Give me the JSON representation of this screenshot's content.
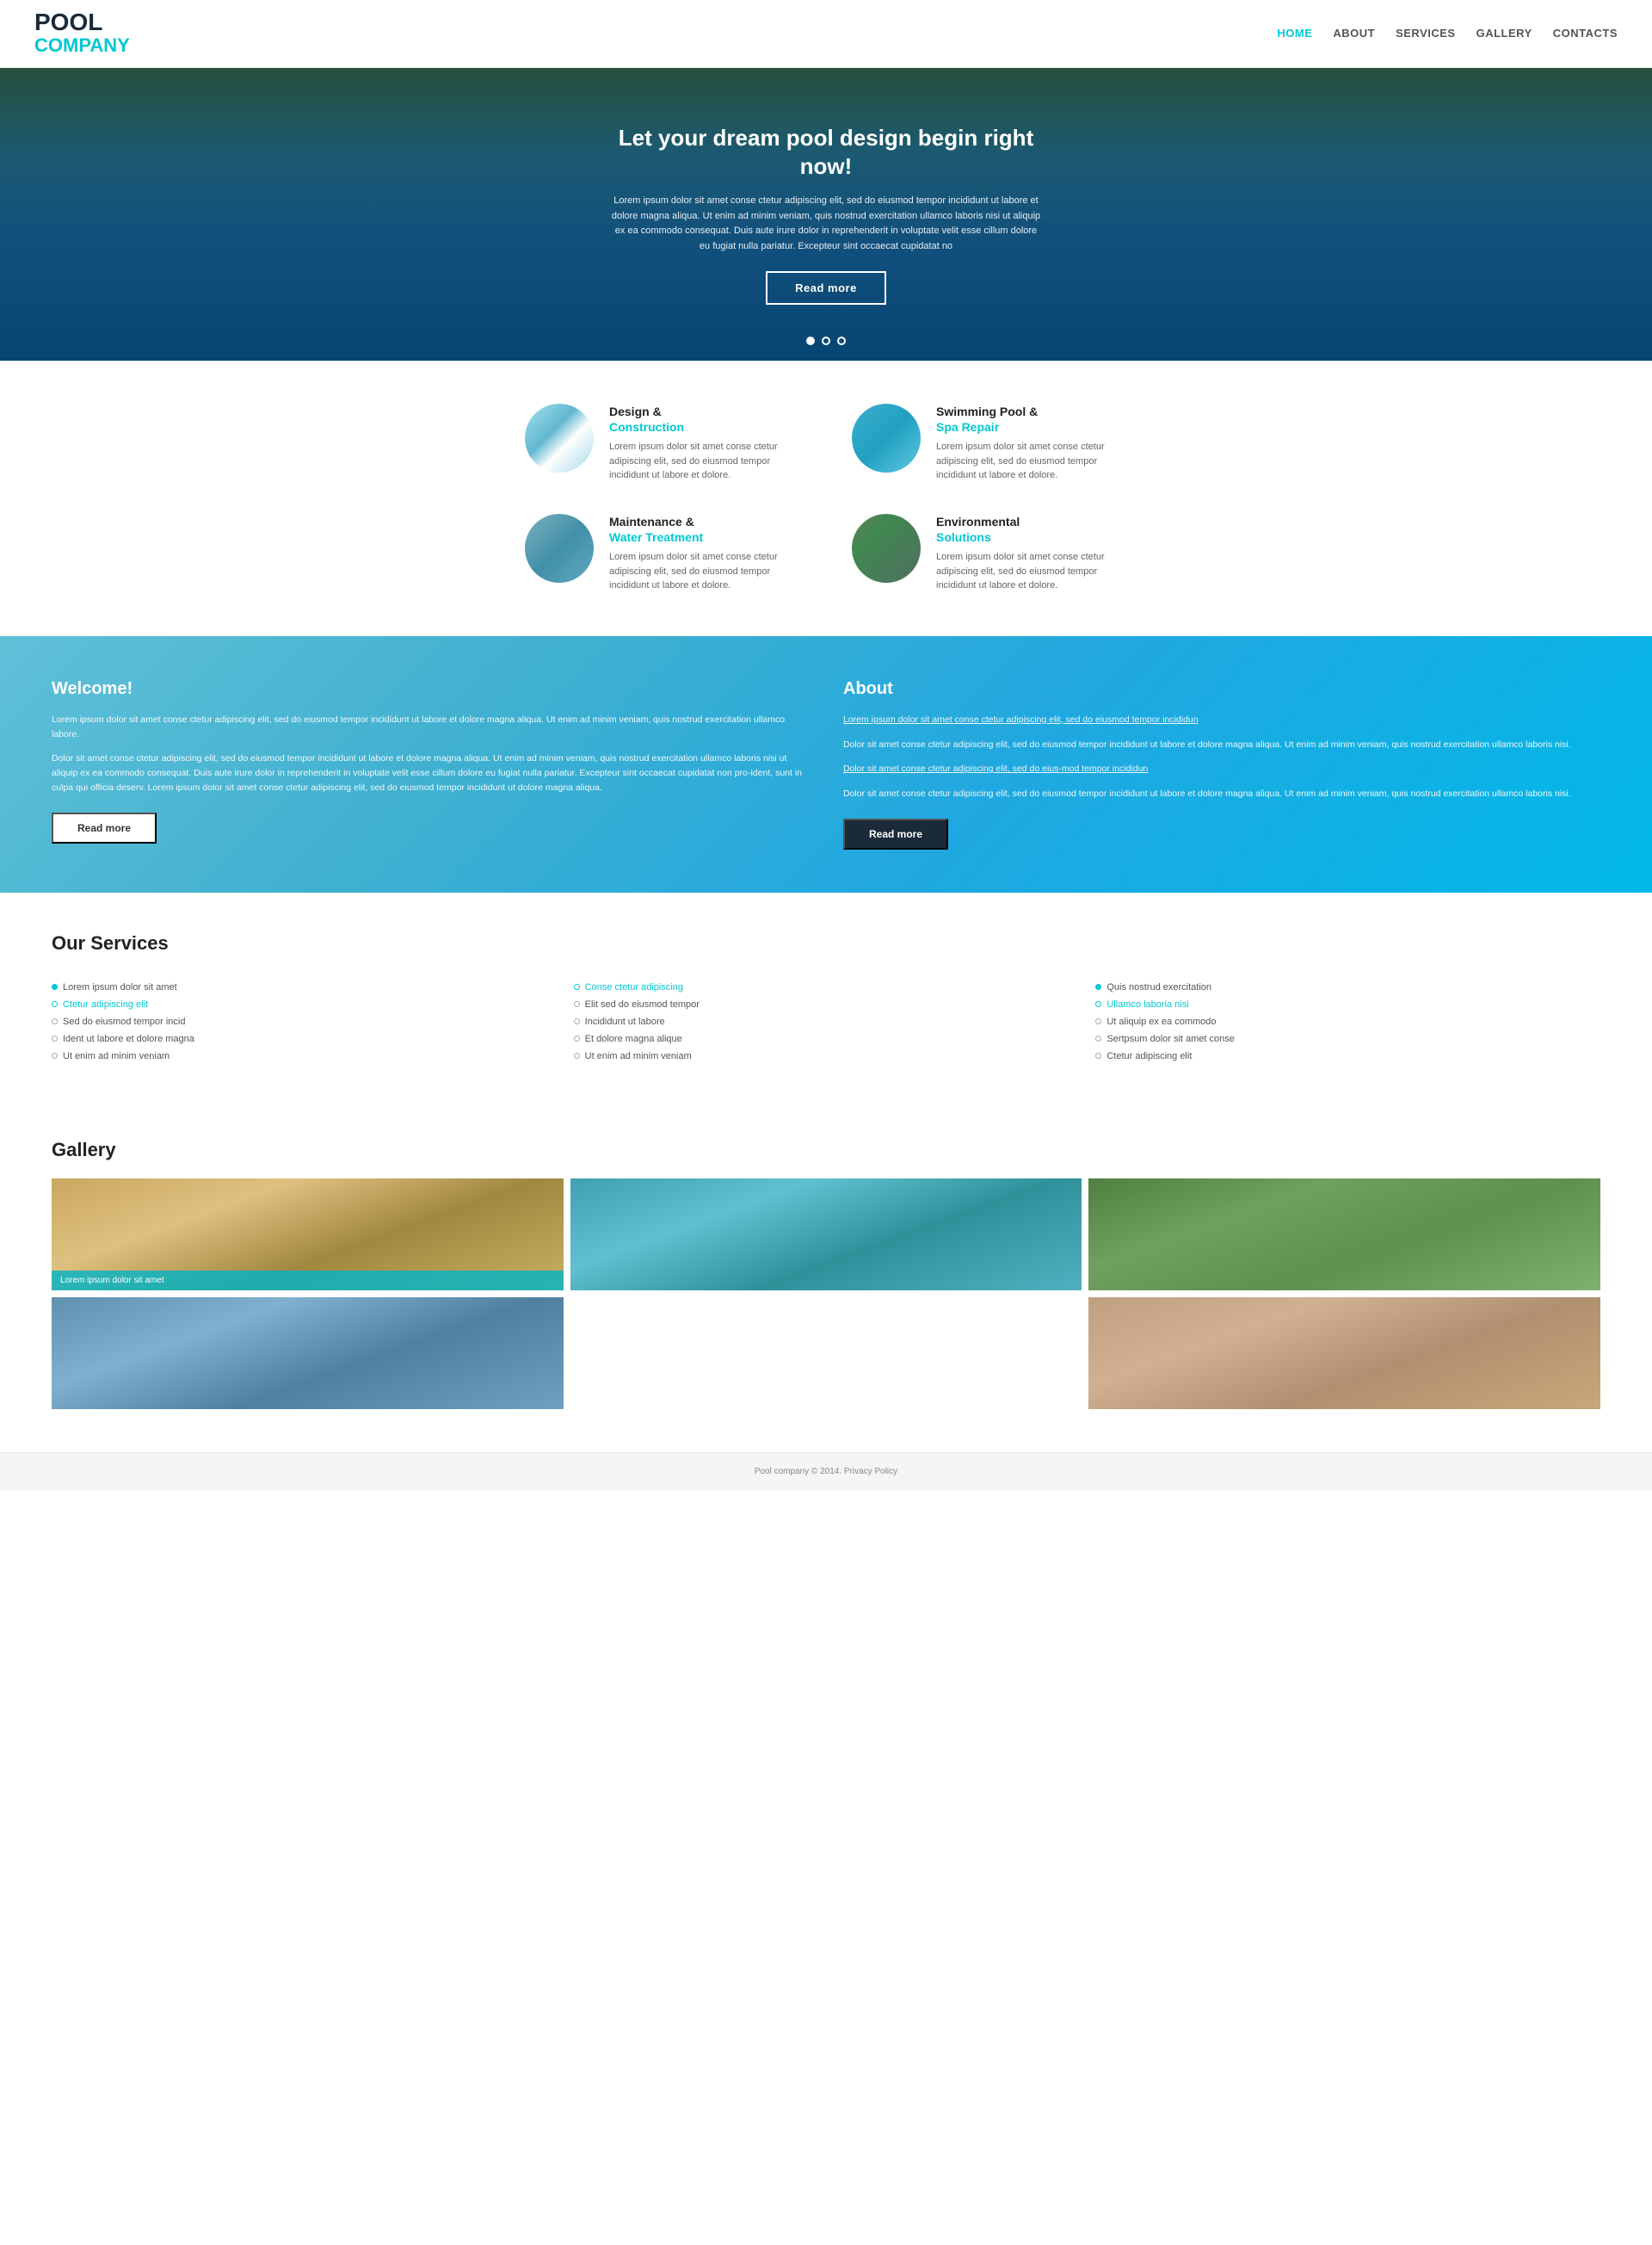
{
  "header": {
    "logo_main": "POOL",
    "logo_sub": "COMPANY",
    "nav": [
      {
        "label": "HOME",
        "active": true
      },
      {
        "label": "ABOUT",
        "active": false
      },
      {
        "label": "SERVICES",
        "active": false
      },
      {
        "label": "GALLERY",
        "active": false
      },
      {
        "label": "CONTACTS",
        "active": false
      }
    ]
  },
  "hero": {
    "title": "Let your dream pool design begin right now!",
    "text": "Lorem ipsum dolor sit amet conse ctetur adipiscing elit, sed do eiusmod tempor incididunt ut labore et dolore magna aliqua. Ut enim ad minim veniam, quis nostrud exercitation ullamco laboris nisi ut aliquip ex ea commodo consequat. Duis aute irure dolor in reprehenderit in voluptate velit esse cillum dolore eu fugiat nulla pariatur. Excepteur sint occaecat cupidatat no",
    "btn": "Read more",
    "dots": [
      1,
      2,
      3
    ]
  },
  "services": [
    {
      "title_line1": "Design &",
      "title_line2": "Construction",
      "text": "Lorem ipsum dolor sit amet conse ctetur adipiscing elit, sed do eiusmod tempor incididunt ut labore et dolore.",
      "img_class": "service-img-pool1"
    },
    {
      "title_line1": "Swimming Pool &",
      "title_line2": "Spa Repair",
      "text": "Lorem ipsum dolor sit amet conse ctetur adipiscing elit, sed do eiusmod tempor incididunt ut labore et dolore.",
      "img_class": "service-img-pool2"
    },
    {
      "title_line1": "Maintenance &",
      "title_line2": "Water Treatment",
      "text": "Lorem ipsum dolor sit amet conse ctetur adipiscing elit, sed do eiusmod tempor incididunt ut labore et dolore.",
      "img_class": "service-img-maintenance"
    },
    {
      "title_line1": "Environmental",
      "title_line2": "Solutions",
      "text": "Lorem ipsum dolor sit amet conse ctetur adipiscing elit, sed do eiusmod tempor incididunt ut labore et dolore.",
      "img_class": "service-img-environmental"
    }
  ],
  "welcome": {
    "title": "Welcome!",
    "para1": "Lorem ipsum dolor sit amet conse ctetur adipiscing elit, sed do eiusmod tempor incididunt ut labore et dolore magna aliqua. Ut enim ad minim veniam, quis nostrud exercitation ullamco labore.",
    "para2": "Dolor sit amet conse ctetur adipiscing elit, sed do eiusmod tempor incididunt ut labore et dolore magna aliqua. Ut enim ad minim veniam, quis nostrud exercitation ullamco laboris nisi ut aliquip ex ea commodo consequat. Duis aute irure dolor in reprehenderit in voluptate velit esse cillum dolore eu fugiat nulla pariatur. Excepteur sint occaecat cupidatat non pro-ident, sunt in culpa qui officia deserv. Lorem ipsum dolor sit amet conse ctetur adipiscing elit, sed do eiusmod tempor incididunt ut dolore magna aliqua.",
    "btn": "Read more"
  },
  "about": {
    "title": "About",
    "link1": "Lorem ipsum dolor sit amet conse ctetur adipiscing elit, sed do eiusmod tempor incididun",
    "para1": "Dolor sit amet conse ctetur adipiscing elit, sed do eiusmod tempor incididunt ut labore et dolore magna aliqua. Ut enim ad minim veniam, quis nostrud exercitation ullamco laboris nisi.",
    "link2": "Dolor sit amet conse ctetur adipiscing elit, sed do eius-mod tempor incididun",
    "para2": "Dolor sit amet conse ctetur adipiscing elit, sed do eiusmod tempor incididunt ut labore et dolore magna aliqua. Ut enim ad minim veniam, quis nostrud exercitation ullamco laboris nisi.",
    "btn": "Read more"
  },
  "our_services": {
    "title": "Our Services",
    "col1": [
      {
        "text": "Lorem ipsum dolor sit amet",
        "type": "filled"
      },
      {
        "text": "Ctetur adipiscing elit",
        "type": "empty-cyan",
        "highlight": true
      },
      {
        "text": "Sed do eiusmod tempor incid",
        "type": "empty"
      },
      {
        "text": "Ident ut labore et dolore magna",
        "type": "empty"
      },
      {
        "text": "Ut enim ad minim veniam",
        "type": "empty"
      }
    ],
    "col2": [
      {
        "text": "Conse ctetur adipiscing",
        "type": "empty-cyan",
        "highlight": true
      },
      {
        "text": "Elit sed do eiusmod tempor",
        "type": "empty"
      },
      {
        "text": "Incididunt ut labore",
        "type": "empty"
      },
      {
        "text": "Et dolore magna alique",
        "type": "empty"
      },
      {
        "text": "Ut enim ad minim veniam",
        "type": "empty"
      }
    ],
    "col3": [
      {
        "text": "Quis nostrud exercitation",
        "type": "filled"
      },
      {
        "text": "Ullamco laboria nisi",
        "type": "empty-cyan",
        "highlight": true
      },
      {
        "text": "Ut aliquip ex ea commodo",
        "type": "empty"
      },
      {
        "text": "Sertpsum dolor sit amet conse",
        "type": "empty"
      },
      {
        "text": "Ctetur adipiscing elit",
        "type": "empty"
      }
    ]
  },
  "gallery": {
    "title": "Gallery",
    "items": [
      {
        "caption": "Lorem ipsum dolor sit amet",
        "has_caption": true,
        "img_class": "g1"
      },
      {
        "caption": "",
        "has_caption": false,
        "img_class": "g2"
      },
      {
        "caption": "",
        "has_caption": false,
        "img_class": "g3"
      },
      {
        "caption": "",
        "has_caption": false,
        "img_class": "g4"
      },
      {
        "caption": "",
        "has_caption": false,
        "img_class": "g5"
      },
      {
        "caption": "",
        "has_caption": false,
        "img_class": "g6"
      }
    ]
  },
  "footer": {
    "text": "Pool company © 2014.",
    "privacy": "Privacy Policy"
  }
}
